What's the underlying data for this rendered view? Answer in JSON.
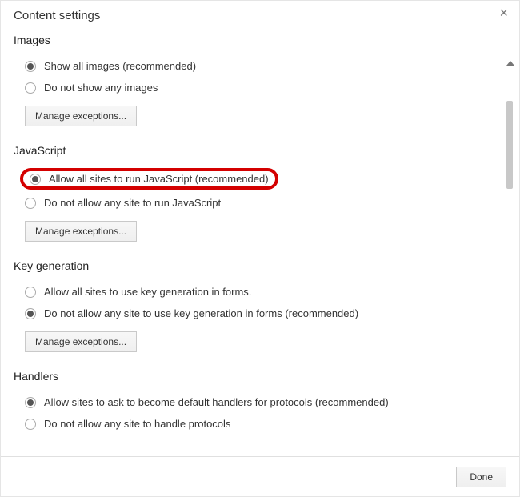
{
  "dialog": {
    "title": "Content settings",
    "done": "Done"
  },
  "sections": {
    "images": {
      "title": "Images",
      "opt1": "Show all images (recommended)",
      "opt2": "Do not show any images",
      "manage": "Manage exceptions..."
    },
    "javascript": {
      "title": "JavaScript",
      "opt1": "Allow all sites to run JavaScript (recommended)",
      "opt2": "Do not allow any site to run JavaScript",
      "manage": "Manage exceptions..."
    },
    "keygen": {
      "title": "Key generation",
      "opt1": "Allow all sites to use key generation in forms.",
      "opt2": "Do not allow any site to use key generation in forms (recommended)",
      "manage": "Manage exceptions..."
    },
    "handlers": {
      "title": "Handlers",
      "opt1": "Allow sites to ask to become default handlers for protocols (recommended)",
      "opt2": "Do not allow any site to handle protocols"
    }
  }
}
